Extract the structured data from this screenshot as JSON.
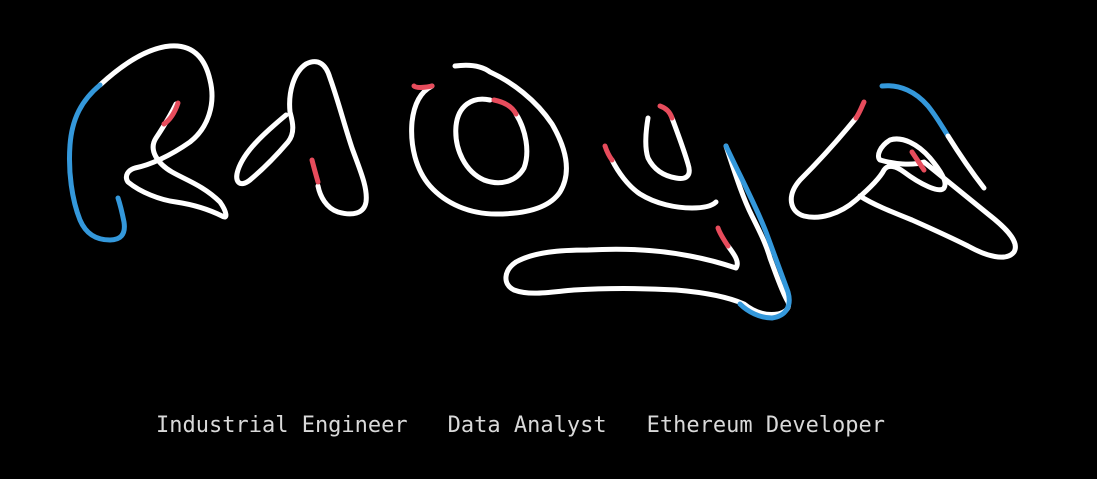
{
  "logo": {
    "text": "RAOYA",
    "colors": {
      "base": "#ffffff",
      "accent_blue": "#3498db",
      "accent_red": "#e74c5c"
    }
  },
  "roles": [
    "Industrial Engineer",
    "Data Analyst",
    "Ethereum Developer"
  ]
}
